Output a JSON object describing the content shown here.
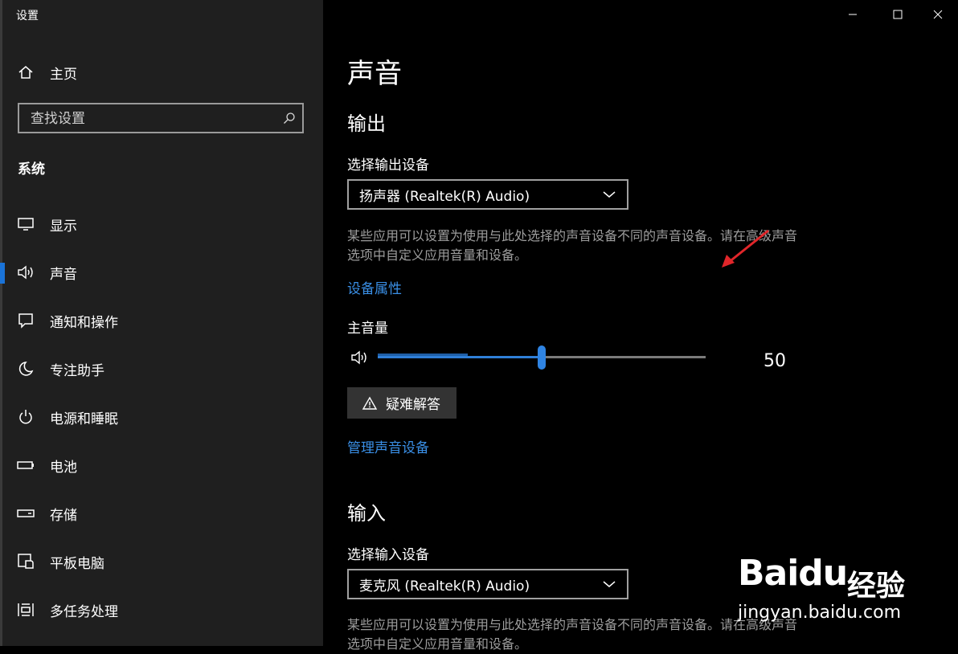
{
  "window": {
    "title": "设置"
  },
  "sidebar": {
    "home_label": "主页",
    "search_placeholder": "查找设置",
    "section_label": "系统",
    "items": [
      {
        "label": "显示",
        "icon": "display-icon"
      },
      {
        "label": "声音",
        "icon": "speaker-icon",
        "selected": true
      },
      {
        "label": "通知和操作",
        "icon": "notification-icon"
      },
      {
        "label": "专注助手",
        "icon": "moon-icon"
      },
      {
        "label": "电源和睡眠",
        "icon": "power-icon"
      },
      {
        "label": "电池",
        "icon": "battery-icon"
      },
      {
        "label": "存储",
        "icon": "storage-icon"
      },
      {
        "label": "平板电脑",
        "icon": "tablet-icon"
      },
      {
        "label": "多任务处理",
        "icon": "multitask-icon"
      }
    ]
  },
  "main": {
    "title": "声音",
    "output": {
      "heading": "输出",
      "select_label": "选择输出设备",
      "device": "扬声器 (Realtek(R) Audio)",
      "description": "某些应用可以设置为使用与此处选择的声音设备不同的声音设备。请在高级声音选项中自定义应用音量和设备。",
      "device_properties_link": "设备属性",
      "volume_label": "主音量",
      "volume_value": "50",
      "volume_fraction": 0.5,
      "troubleshoot_label": "疑难解答",
      "manage_link": "管理声音设备"
    },
    "input": {
      "heading": "输入",
      "select_label": "选择输入设备",
      "device": "麦克风 (Realtek(R) Audio)",
      "description": "某些应用可以设置为使用与此处选择的声音设备不同的声音设备。请在高级声音选项中自定义应用音量和设备。"
    }
  },
  "watermark": {
    "brand": "Baidu",
    "product": "经验",
    "url": "jingyan.baidu.com"
  },
  "colors": {
    "accent": "#2f84e3",
    "link": "#3a8fe6",
    "sidebar_bg": "#1f1f1f",
    "annotation_arrow": "#e0262a"
  }
}
